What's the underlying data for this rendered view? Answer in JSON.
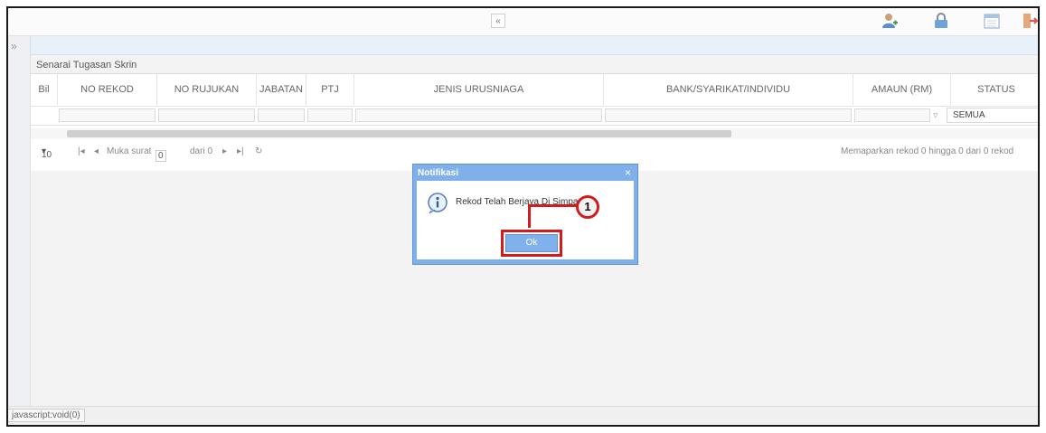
{
  "header": {
    "collapse_glyph": "«",
    "icons": [
      "user-add-icon",
      "lock-icon",
      "calendar-icon",
      "exit-icon"
    ]
  },
  "sidebar": {
    "toggle_glyph": "»"
  },
  "screen_list": {
    "title": "Senarai Tugasan Skrin",
    "columns": [
      "Bil",
      "NO REKOD",
      "NO RUJUKAN",
      "JABATAN",
      "PTJ",
      "JENIS URUSNIAGA",
      "BANK/SYARIKAT/INDIVIDU",
      "AMAUN (RM)",
      "STATUS"
    ],
    "status_filter": {
      "selected": "SEMUA"
    }
  },
  "pager": {
    "page_size": "10",
    "page_label": "Muka surat",
    "page_value": "0",
    "of_label": "dari 0",
    "summary": "Memaparkan rekod 0 hingga 0 dari 0 rekod"
  },
  "dialog": {
    "title": "Notifikasi",
    "close_glyph": "×",
    "message": "Rekod Telah Berjaya Di Simpan",
    "ok_label": "Ok"
  },
  "annotation": {
    "step_number": "1",
    "color": "#d21b1b"
  },
  "statusbar": {
    "link_text": "javascript:void(0)"
  },
  "colors": {
    "dialog_frame": "#7fb0ea",
    "highlight": "#d21b1b"
  }
}
